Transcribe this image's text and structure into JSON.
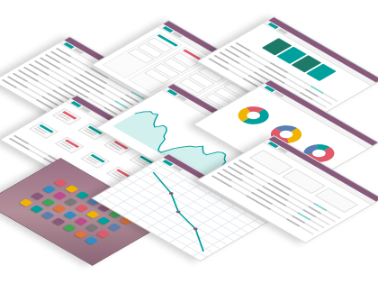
{
  "colors": {
    "brand": "#875a7b",
    "accent": "#00a09d",
    "accent_light": "#7fd3cf",
    "accent_dark": "#1d7a68",
    "neutral": "#cfcfcf",
    "chart_line": "#00a09d",
    "donut": [
      "#00a09d",
      "#f0b400",
      "#e05a6b",
      "#5a7fb3"
    ],
    "app_icons": [
      "#e05a6b",
      "#f0b400",
      "#00a09d",
      "#5a7fb3",
      "#875a7b",
      "#3fa55a",
      "#e0743a",
      "#2e8fc8",
      "#c04a8e",
      "#7a7a7a"
    ]
  },
  "screens": [
    {
      "id": "list-view",
      "kind": "list"
    },
    {
      "id": "kanban-board",
      "kind": "kanban"
    },
    {
      "id": "pos-tiles",
      "kind": "tiles"
    },
    {
      "id": "dashboard-kpis",
      "kind": "kpi"
    },
    {
      "id": "line-graph",
      "kind": "line"
    },
    {
      "id": "pie-charts",
      "kind": "donut"
    },
    {
      "id": "app-launcher",
      "kind": "launcher"
    },
    {
      "id": "map-view",
      "kind": "map"
    },
    {
      "id": "form-view",
      "kind": "form"
    }
  ]
}
